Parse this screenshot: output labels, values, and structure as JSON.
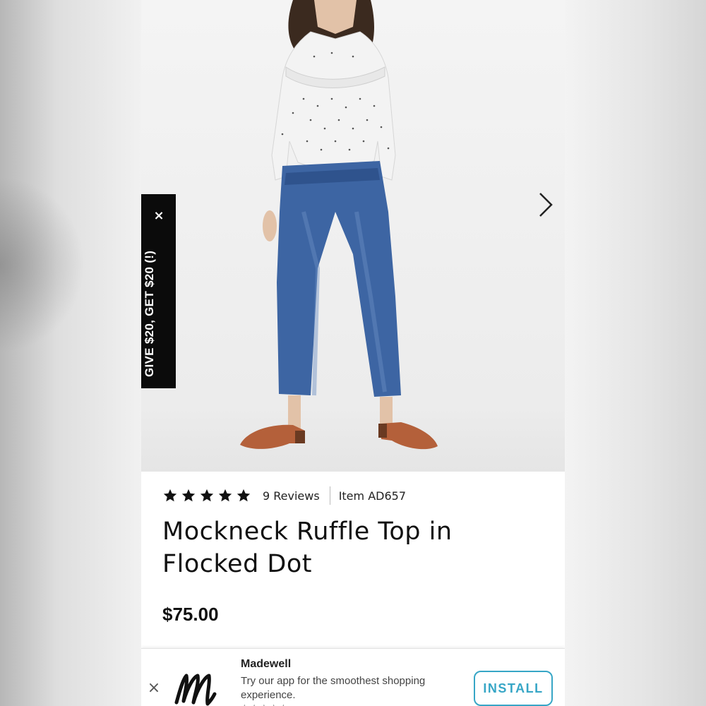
{
  "promo": {
    "label": "GIVE $20, GET $20 (!)",
    "close_glyph": "×"
  },
  "product": {
    "rating_stars": 5,
    "reviews": "9 Reviews",
    "item_number": "Item AD657",
    "title": "Mockneck Ruffle Top in Flocked Dot",
    "price": "$75.00"
  },
  "gallery": {
    "next_icon": "chevron-right-icon"
  },
  "app_banner": {
    "close_glyph": "×",
    "app_name": "Madewell",
    "description": "Try our app for the smoothest shopping experience.",
    "install_label": "INSTALL",
    "rating_glyphs": "★★★★★"
  },
  "colors": {
    "promo_bg": "#0b0b0b",
    "install_accent": "#37a6c6",
    "text": "#111111"
  }
}
